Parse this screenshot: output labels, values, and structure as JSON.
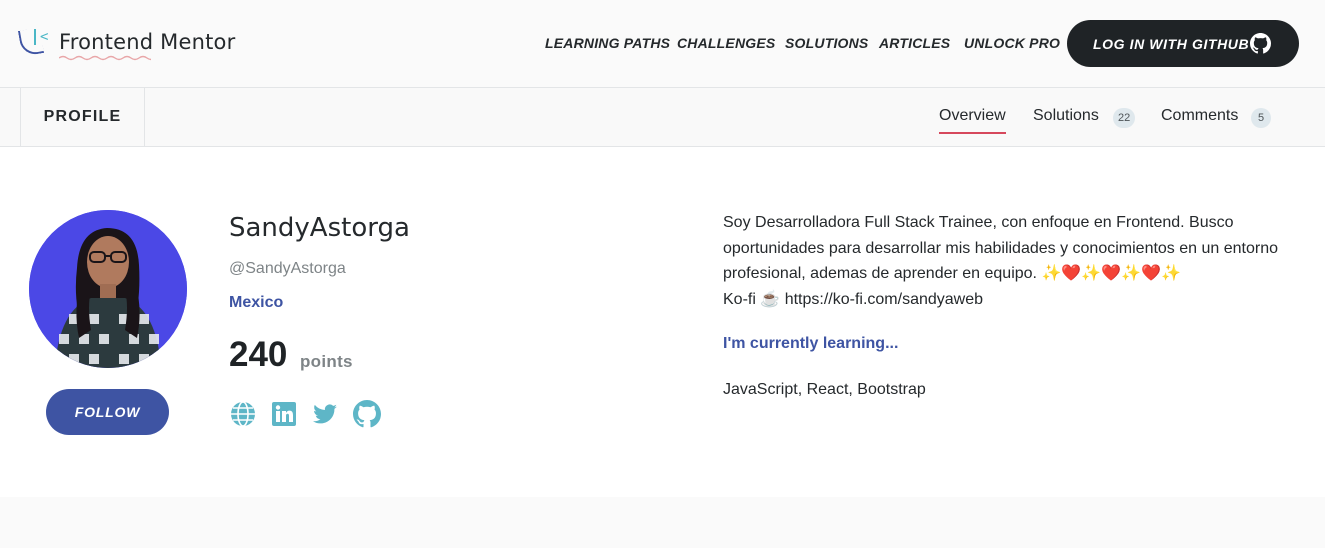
{
  "header": {
    "logo_text": "Frontend Mentor",
    "nav": [
      "LEARNING PATHS",
      "CHALLENGES",
      "SOLUTIONS",
      "ARTICLES",
      "UNLOCK PRO"
    ],
    "login_label": "LOG IN WITH GITHUB"
  },
  "subheader": {
    "section_label": "PROFILE",
    "tabs": {
      "overview": "Overview",
      "solutions": "Solutions",
      "solutions_count": "22",
      "comments": "Comments",
      "comments_count": "5"
    }
  },
  "profile": {
    "name": "SandyAstorga",
    "handle": "@SandyAstorga",
    "location": "Mexico",
    "points": "240",
    "points_label": "points",
    "follow_label": "FOLLOW",
    "social_icons": [
      "globe-icon",
      "linkedin-icon",
      "twitter-icon",
      "github-icon"
    ],
    "bio_line1": "Soy Desarrolladora Full Stack Trainee, con enfoque en Frontend. Busco oportunidades para desarrollar mis habilidades y conocimientos en un entorno profesional, ademas de aprender en equipo. ✨❤️✨❤️✨❤️✨",
    "bio_line2": "Ko-fi ☕ https://ko-fi.com/sandyaweb",
    "learning_title": "I'm currently learning...",
    "learning_list": "JavaScript, React, Bootstrap"
  },
  "colors": {
    "accent_blue": "#3e54a3",
    "accent_teal": "#4ab7c6",
    "accent_red": "#d6485c",
    "dark": "#1f2326"
  }
}
